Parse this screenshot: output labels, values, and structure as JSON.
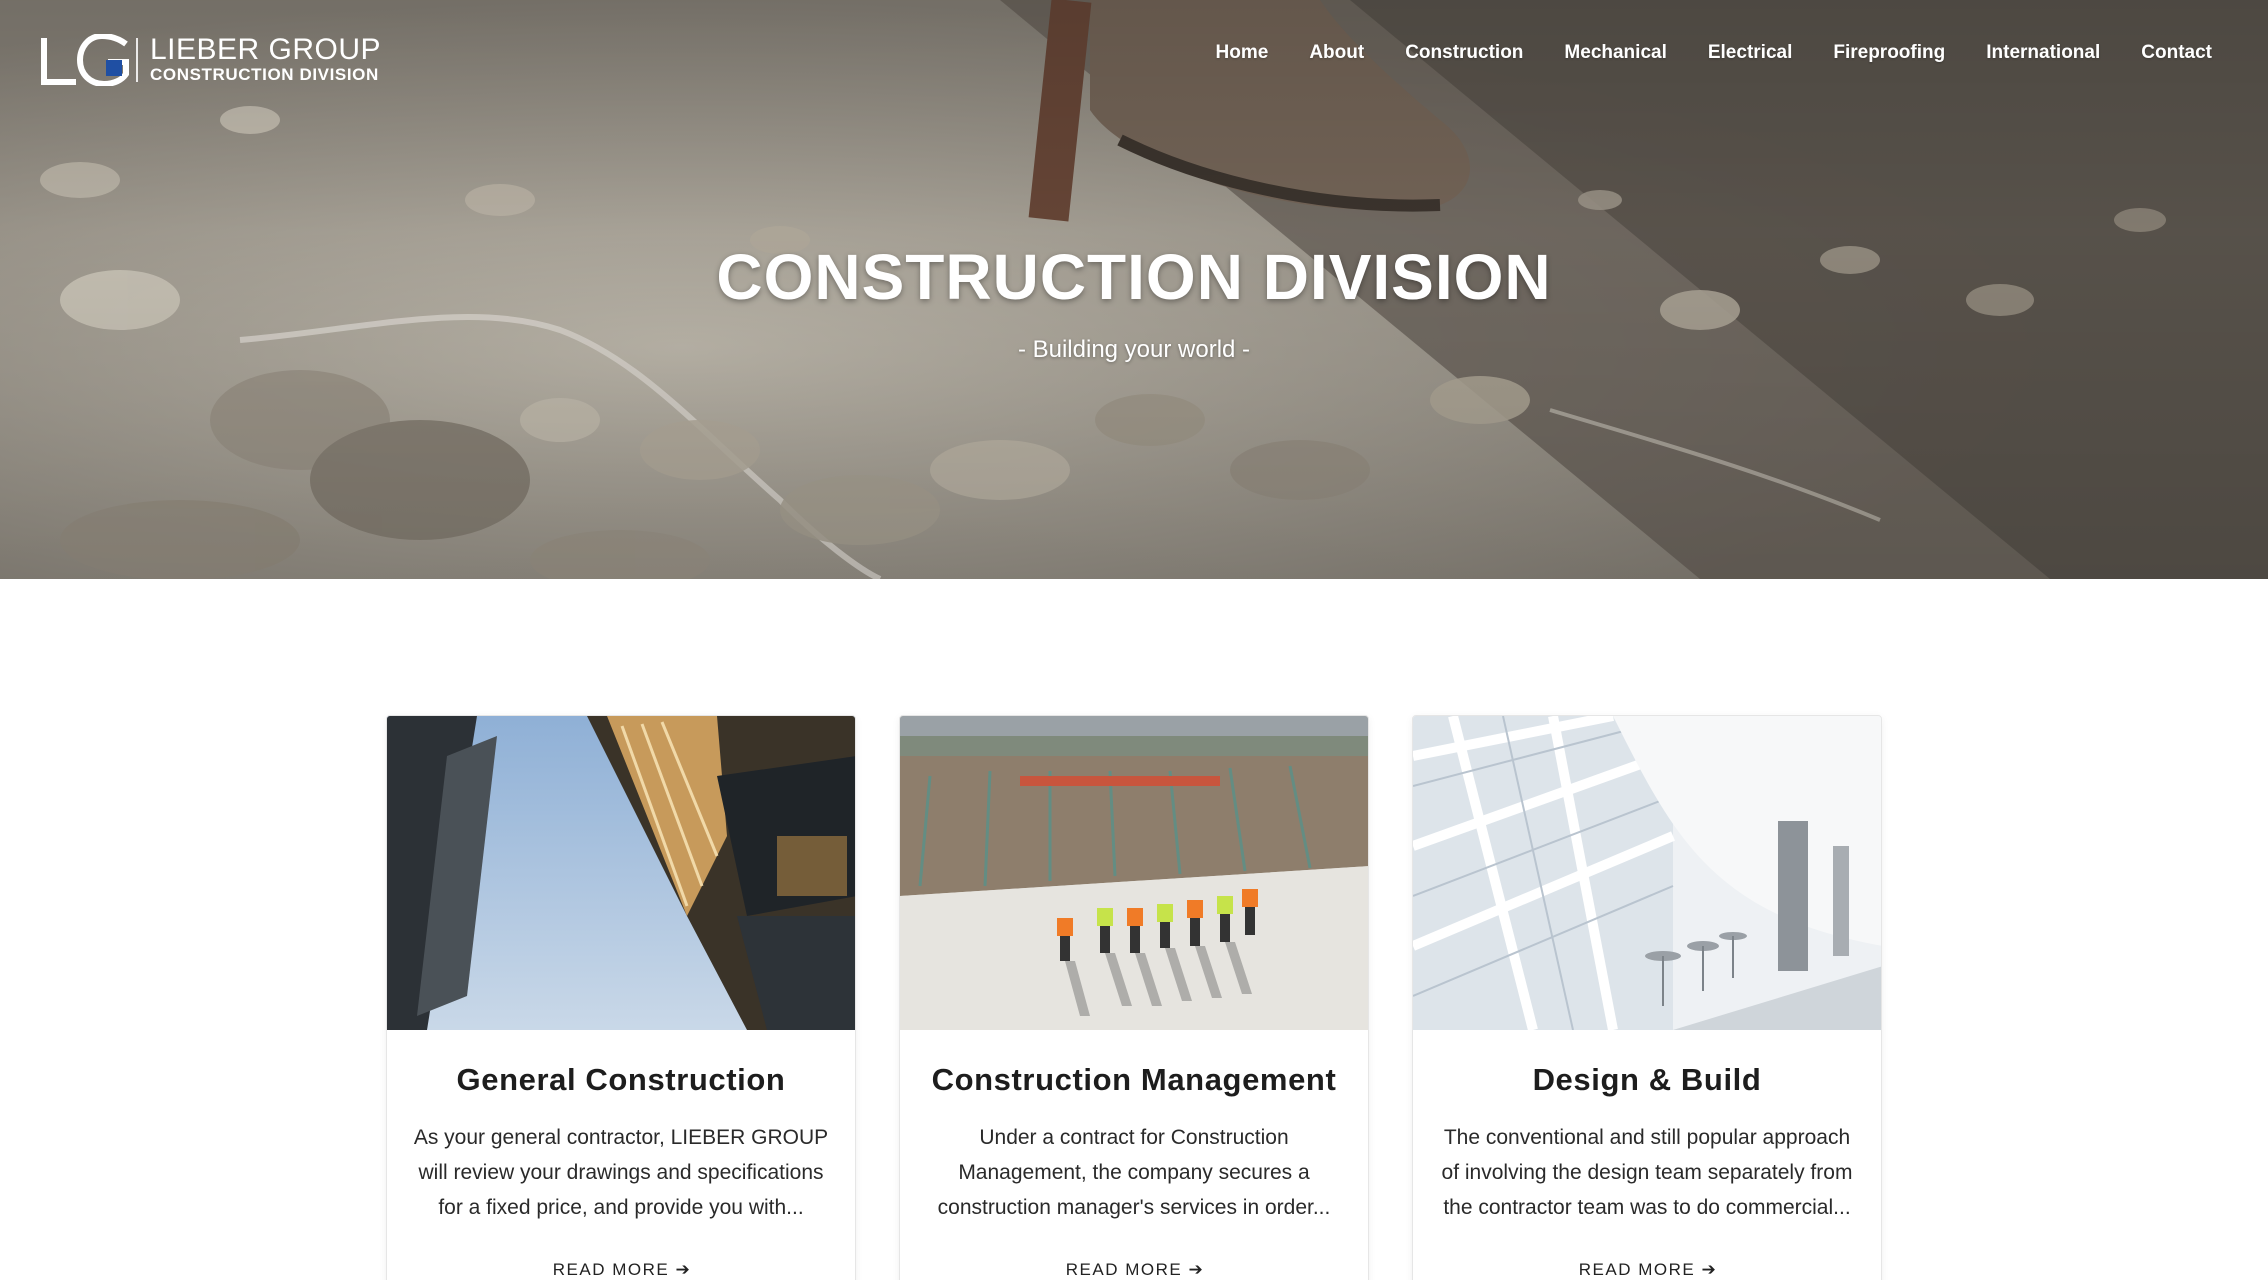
{
  "brand": {
    "logo_letters": "LG",
    "name": "LIEBER GROUP",
    "division": "CONSTRUCTION DIVISION"
  },
  "nav": [
    {
      "label": "Home"
    },
    {
      "label": "About"
    },
    {
      "label": "Construction"
    },
    {
      "label": "Mechanical"
    },
    {
      "label": "Electrical"
    },
    {
      "label": "Fireproofing"
    },
    {
      "label": "International"
    },
    {
      "label": "Contact"
    }
  ],
  "hero": {
    "title": "CONSTRUCTION DIVISION",
    "subtitle": "- Building your world -"
  },
  "cards": [
    {
      "title": "General Construction",
      "text": "As your general contractor, LIEBER GROUP will review your drawings and specifications for a fixed price, and provide you with...",
      "link": "READ MORE"
    },
    {
      "title": "Construction Management",
      "text": "Under a contract for Construction Management, the company secures a construction manager's services in order...",
      "link": "READ MORE"
    },
    {
      "title": "Design & Build",
      "text": "The conventional and still popular approach of involving the design team separately from the contractor team was to do commercial...",
      "link": "READ MORE"
    }
  ],
  "icons": {
    "arrow": "arrow-right-icon"
  },
  "colors": {
    "logo_accent": "#1f4fa3",
    "text_dark": "#1d1d1d"
  }
}
